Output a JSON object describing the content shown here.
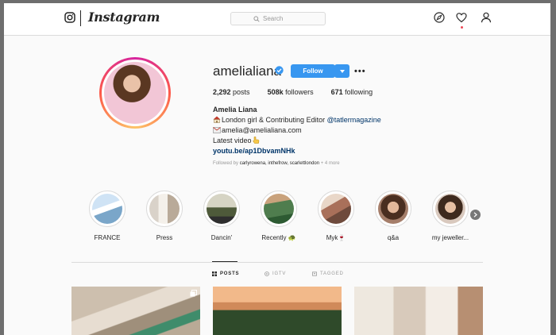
{
  "nav": {
    "logo_text": "Instagram",
    "search_placeholder": "Search"
  },
  "profile": {
    "username": "amelialiana",
    "verified": true,
    "follow_label": "Follow",
    "posts_count": "2,292",
    "posts_label": "posts",
    "followers_count": "508k",
    "followers_label": "followers",
    "following_count": "671",
    "following_label": "following",
    "full_name": "Amelia Liana",
    "bio": {
      "line1_text": "London girl & Contributing Editor ",
      "line1_mention": "@tatlermagazine",
      "line2_text": "amelia@amelialiana.com",
      "line3_text": "Latest video",
      "link": "youtu.be/ap1DbvamNHk"
    },
    "followed_by_prefix": "Followed by ",
    "followed_by_names": "carlyrowena, inthefrow, scarlettlondon",
    "followed_by_more": " + 4 more"
  },
  "highlights": [
    {
      "label": "FRANCE"
    },
    {
      "label": "Press"
    },
    {
      "label": "Dancin'"
    },
    {
      "label": "Recently 🐢"
    },
    {
      "label": "Myk🍷"
    },
    {
      "label": "q&a"
    },
    {
      "label": "my jeweller..."
    }
  ],
  "tabs": [
    {
      "label": "POSTS",
      "icon": "grid-icon",
      "active": true
    },
    {
      "label": "IGTV",
      "icon": "igtv-icon",
      "active": false
    },
    {
      "label": "TAGGED",
      "icon": "tag-icon",
      "active": false
    }
  ],
  "colors": {
    "accent": "#3897f0",
    "link": "#003569",
    "notification": "#ed4956"
  }
}
